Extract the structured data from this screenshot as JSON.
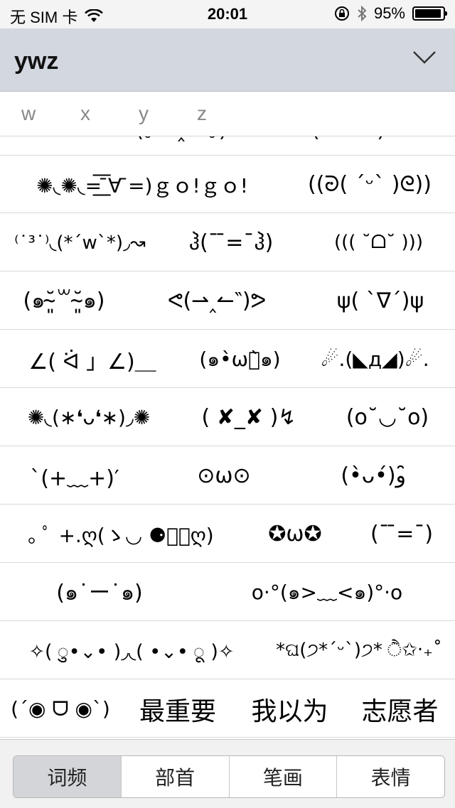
{
  "status_bar": {
    "carrier": "无 SIM 卡",
    "time": "20:01",
    "battery_text": "95%",
    "battery_level": 0.95
  },
  "header": {
    "title": "ywz",
    "toggle_icon": "chevron-down-icon"
  },
  "pinyin": [
    "w",
    "x",
    "y",
    "z"
  ],
  "emoticon_rows": [
    [
      "(´·ω·`)",
      "(｡•ˇ‸ˇ•｡)",
      "(・∀・)"
    ],
    [
      "✺◟✺◟=͟͟͞͞ ̄∀ ̄=)ｇｏ!ｇｏ!",
      "((ᘒ( ´ᵕ` )ᘓ))"
    ],
    [
      "⁽˙³˙⁾◟(*´w`*)◞↝",
      "ჰ(¯ ̄=¯ჰ)",
      "((( ˘ᗝ˘ )))"
    ],
    [
      "(๑˘̴͈꒳˘̴͈๑)",
      "ᕙ(⇀‸↼‶)ᕗ",
      "ψ( `∇´)ψ"
    ],
    [
      "∠( ᐛ 」∠)＿",
      "(๑•̀ωก̀๑)",
      "☄.(◣д◢)☄."
    ],
    [
      "✺◟(∗❛ᴗ❛∗)◞✺",
      "( ✘_✘ )↯",
      "(o˘◡˘o)"
    ],
    [
      "`(+﹏+)′",
      "⊙ω⊙",
      "(•̀ᴗ•́)و ̑̑"
    ],
    [
      "｡ ﾟ +.ღ(ゝ◡ ⚈᷀᷁ღ)",
      "✪ω✪",
      "(¯ ̄=¯)"
    ],
    [
      "(๑˙ー˙๑)",
      "o·°(๑>﹏<๑)°·o"
    ],
    [
      "✧( ु•⌄• )◞◟( •⌄• ू )✧",
      "*ଘ(੭*ˊᵕˋ)੭* ੈ✩‧₊˚"
    ],
    [
      "(´◉ ᗜ ◉`)",
      "最重要",
      "我以为",
      "志愿者"
    ]
  ],
  "tabs": [
    "词频",
    "部首",
    "笔画",
    "表情"
  ],
  "active_tab": "词频"
}
